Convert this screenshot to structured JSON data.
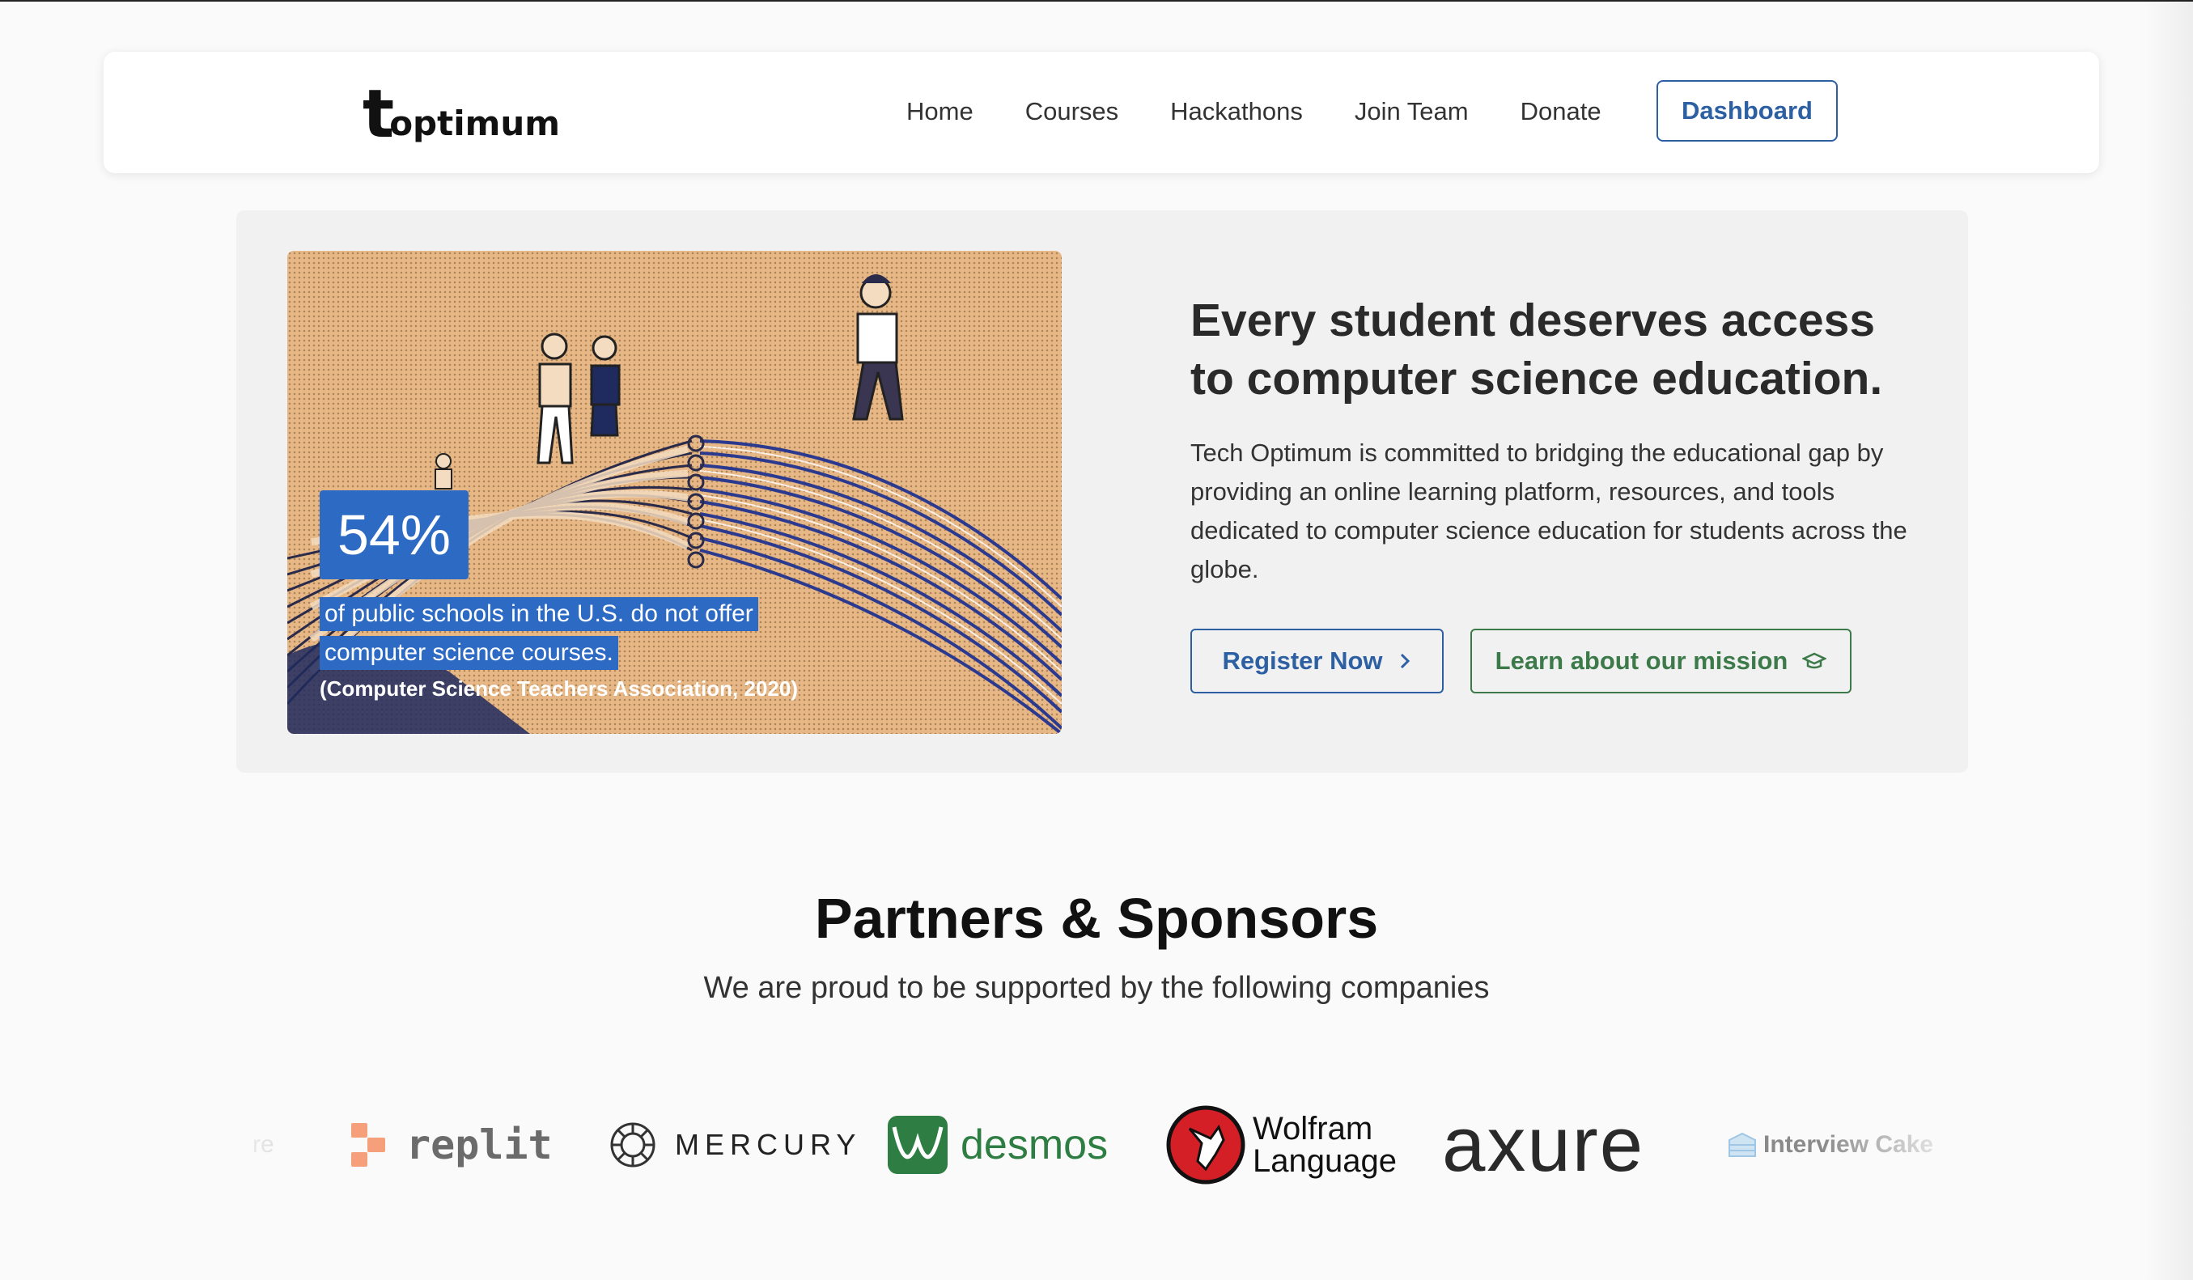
{
  "nav": {
    "logo_t": "t",
    "logo_rest": "optimum",
    "links": [
      "Home",
      "Courses",
      "Hackathons",
      "Join Team",
      "Donate"
    ],
    "dashboard_label": "Dashboard"
  },
  "hero": {
    "stat_value": "54%",
    "stat_line1": "of public schools in the U.S. do not offer",
    "stat_line2": "computer science courses.",
    "stat_source": "(Computer Science Teachers Association, 2020)",
    "title": "Every student deserves access to computer science education.",
    "body": "Tech Optimum is committed to bridging the educational gap by providing an online learning platform, resources, and tools dedicated to computer science education for students across the globe.",
    "register_label": "Register Now",
    "mission_label": "Learn about our mission"
  },
  "partners": {
    "title": "Partners & Sponsors",
    "subtitle": "We are proud to be supported by the following companies",
    "logos": {
      "partial_left": "re",
      "replit": "replit",
      "mercury": "MERCURY",
      "desmos": "desmos",
      "wolfram_1": "Wolfram",
      "wolfram_2": "Language",
      "axure": "axure",
      "interview_cake": "Interview Cake"
    }
  },
  "colors": {
    "primary_blue": "#2d5fa3",
    "mission_green": "#3c7a4a",
    "stat_blue": "#2d6ac4",
    "hero_bg": "#f1f1f1",
    "illustration_orange": "#e7b886"
  },
  "icons": {
    "register": "chevron-right-icon",
    "mission": "graduation-cap-icon"
  }
}
